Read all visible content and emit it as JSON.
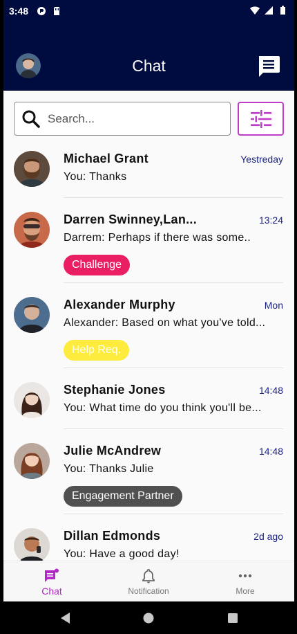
{
  "status_bar": {
    "time": "3:48"
  },
  "app_bar": {
    "title": "Chat"
  },
  "search": {
    "placeholder": "Search..."
  },
  "chats": [
    {
      "name": "Michael Grant",
      "time": "Yestreday",
      "preview": "You: Thanks",
      "tag": null
    },
    {
      "name": "Darren Swinney,Lan...",
      "time": "13:24",
      "preview": "Darrem: Perhaps if there was some..",
      "tag": {
        "label": "Challenge",
        "color": "#e91e63",
        "text_color": "#ffffff"
      }
    },
    {
      "name": "Alexander Murphy",
      "time": "Mon",
      "preview": "Alexander: Based on what you've told...",
      "tag": {
        "label": "Help Req.",
        "color": "#fdeb3d",
        "text_color": "#ffffff"
      }
    },
    {
      "name": "Stephanie Jones",
      "time": "14:48",
      "preview": "You: What time do you think you'll be...",
      "tag": null
    },
    {
      "name": "Julie McAndrew",
      "time": "14:48",
      "preview": "You: Thanks Julie",
      "tag": {
        "label": "Engagement Partner",
        "color": "#505050",
        "text_color": "#ffffff"
      }
    },
    {
      "name": "Dillan Edmonds",
      "time": "2d ago",
      "preview": "You: Have a good day!",
      "tag": null
    }
  ],
  "bottom_nav": [
    {
      "label": "Chat",
      "icon": "chat-icon",
      "active": true
    },
    {
      "label": "Notification",
      "icon": "bell-icon",
      "active": false
    },
    {
      "label": "More",
      "icon": "more-icon",
      "active": false
    }
  ],
  "colors": {
    "header_bg": "#000b3f",
    "accent": "#b128c5",
    "time_text": "#1a237e"
  }
}
